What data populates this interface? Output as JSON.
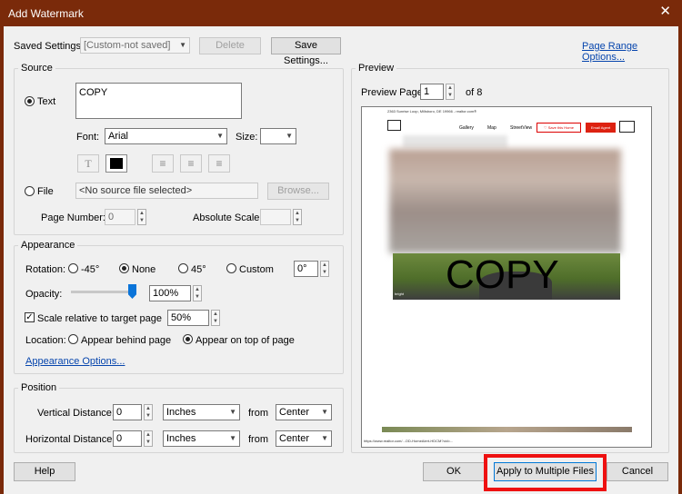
{
  "window": {
    "title": "Add Watermark",
    "close_glyph": "✕"
  },
  "saved_settings": {
    "label": "Saved Settings:",
    "value": "[Custom-not saved]",
    "delete_label": "Delete",
    "save_label": "Save Settings..."
  },
  "page_range_label": "Page Range Options...",
  "source": {
    "title": "Source",
    "text_label": "Text",
    "text_value": "COPY",
    "font_label": "Font:",
    "font_value": "Arial",
    "size_label": "Size:",
    "size_value": "",
    "text_icon": "T",
    "align_left_icon": "≡",
    "align_center_icon": "≡",
    "align_right_icon": "≡",
    "file_label": "File",
    "file_value": "<No source file selected>",
    "browse_label": "Browse...",
    "page_number_label": "Page Number:",
    "page_number_value": "0",
    "absolute_scale_label": "Absolute Scale:"
  },
  "appearance": {
    "title": "Appearance",
    "rotation_label": "Rotation:",
    "rot_m45": "-45°",
    "rot_none": "None",
    "rot_45": "45°",
    "rot_custom": "Custom",
    "rot_custom_value": "0°",
    "opacity_label": "Opacity:",
    "opacity_value": "100%",
    "scale_label": "Scale relative to target page",
    "scale_value": "50%",
    "location_label": "Location:",
    "loc_behind": "Appear behind page",
    "loc_top": "Appear on top of page",
    "options_link": "Appearance Options..."
  },
  "position": {
    "title": "Position",
    "vertical_label": "Vertical Distance:",
    "vertical_value": "0",
    "vertical_unit": "Inches",
    "vertical_from_label": "from",
    "vertical_from": "Center",
    "horizontal_label": "Horizontal Distance:",
    "horizontal_value": "0",
    "horizontal_unit": "Inches",
    "horizontal_from_label": "from",
    "horizontal_from": "Center"
  },
  "preview": {
    "title": "Preview",
    "page_label": "Preview Page",
    "page_value": "1",
    "of_label": "of 8",
    "doc_header": "2363 Sunrise Loop, Millsboro, DE 19966 - realtor.com®",
    "nav_gallery": "Gallery",
    "nav_map": "Map",
    "nav_streetview": "StreetView",
    "save_home": "♡ Save this Home",
    "email_agent": "Email Agent",
    "watermark_text": "COPY",
    "img_caption": "bright",
    "doc_footer": "https://www.realtor.com/...OD-HomeAlert-HDCM?cid=..."
  },
  "footer": {
    "help": "Help",
    "ok": "OK",
    "apply_multiple": "Apply to Multiple Files",
    "cancel": "Cancel"
  }
}
